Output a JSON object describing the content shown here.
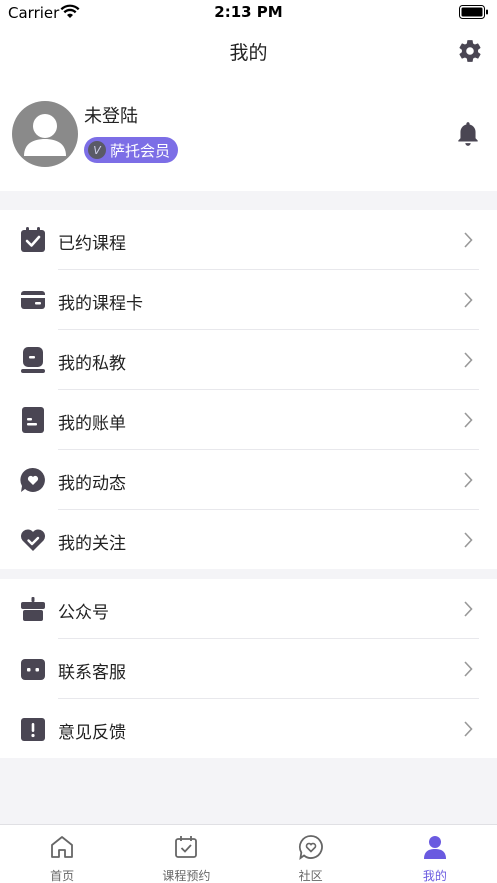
{
  "status_bar": {
    "carrier": "Carrier",
    "time": "2:13 PM"
  },
  "header": {
    "title": "我的"
  },
  "profile": {
    "username": "未登陆",
    "member_label": "萨托会员"
  },
  "menu_group_1": [
    {
      "label": "已约课程",
      "icon": "calendar-check-icon"
    },
    {
      "label": "我的课程卡",
      "icon": "card-icon"
    },
    {
      "label": "我的私教",
      "icon": "coach-icon"
    },
    {
      "label": "我的账单",
      "icon": "bill-icon"
    },
    {
      "label": "我的动态",
      "icon": "chat-heart-icon"
    },
    {
      "label": "我的关注",
      "icon": "heart-check-icon"
    }
  ],
  "menu_group_2": [
    {
      "label": "公众号",
      "icon": "gift-box-icon"
    },
    {
      "label": "联系客服",
      "icon": "service-icon"
    },
    {
      "label": "意见反馈",
      "icon": "feedback-icon"
    }
  ],
  "tabs": [
    {
      "label": "首页",
      "icon": "home-icon",
      "active": false
    },
    {
      "label": "课程预约",
      "icon": "calendar-check-icon",
      "active": false
    },
    {
      "label": "社区",
      "icon": "chat-heart-icon",
      "active": false
    },
    {
      "label": "我的",
      "icon": "user-icon",
      "active": true
    }
  ],
  "colors": {
    "accent": "#6a5ae0",
    "icon_dark": "#4a4653",
    "badge": "#7c6ee6"
  }
}
